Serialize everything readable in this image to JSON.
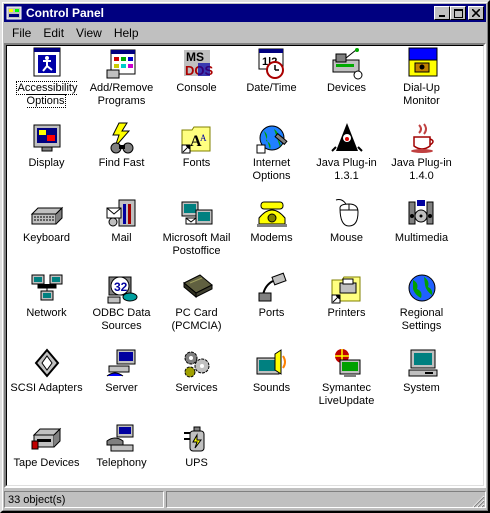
{
  "window": {
    "title": "Control Panel"
  },
  "menu": [
    "File",
    "Edit",
    "View",
    "Help"
  ],
  "items": [
    {
      "label": "Accessibility Options",
      "icon": "accessibility-icon"
    },
    {
      "label": "Add/Remove Programs",
      "icon": "add-remove-programs-icon"
    },
    {
      "label": "Console",
      "icon": "console-icon"
    },
    {
      "label": "Date/Time",
      "icon": "date-time-icon"
    },
    {
      "label": "Devices",
      "icon": "devices-icon"
    },
    {
      "label": "Dial-Up Monitor",
      "icon": "dial-up-monitor-icon"
    },
    {
      "label": "Display",
      "icon": "display-icon"
    },
    {
      "label": "Find Fast",
      "icon": "find-fast-icon"
    },
    {
      "label": "Fonts",
      "icon": "fonts-folder-icon"
    },
    {
      "label": "Internet Options",
      "icon": "internet-options-icon"
    },
    {
      "label": "Java Plug-in 1.3.1",
      "icon": "java-duke-icon"
    },
    {
      "label": "Java Plug-in 1.4.0",
      "icon": "java-cup-icon"
    },
    {
      "label": "Keyboard",
      "icon": "keyboard-icon"
    },
    {
      "label": "Mail",
      "icon": "mail-icon"
    },
    {
      "label": "Microsoft Mail Postoffice",
      "icon": "mail-postoffice-icon"
    },
    {
      "label": "Modems",
      "icon": "modem-telephone-icon"
    },
    {
      "label": "Mouse",
      "icon": "mouse-icon"
    },
    {
      "label": "Multimedia",
      "icon": "multimedia-icon"
    },
    {
      "label": "Network",
      "icon": "network-icon"
    },
    {
      "label": "ODBC Data Sources",
      "icon": "odbc-icon"
    },
    {
      "label": "PC Card (PCMCIA)",
      "icon": "pc-card-icon"
    },
    {
      "label": "Ports",
      "icon": "ports-plug-icon"
    },
    {
      "label": "Printers",
      "icon": "printers-folder-icon"
    },
    {
      "label": "Regional Settings",
      "icon": "globe-icon"
    },
    {
      "label": "SCSI Adapters",
      "icon": "scsi-icon"
    },
    {
      "label": "Server",
      "icon": "server-icon"
    },
    {
      "label": "Services",
      "icon": "services-gears-icon"
    },
    {
      "label": "Sounds",
      "icon": "speaker-icon"
    },
    {
      "label": "Symantec LiveUpdate",
      "icon": "liveupdate-icon"
    },
    {
      "label": "System",
      "icon": "computer-icon"
    },
    {
      "label": "Tape Devices",
      "icon": "tape-drive-icon"
    },
    {
      "label": "Telephony",
      "icon": "telephony-icon"
    },
    {
      "label": "UPS",
      "icon": "ups-battery-icon"
    }
  ],
  "status": {
    "text": "33 object(s)"
  },
  "colors": {
    "titlebar": "#000080",
    "face": "#c0c0c0",
    "content": "#ffffff"
  }
}
